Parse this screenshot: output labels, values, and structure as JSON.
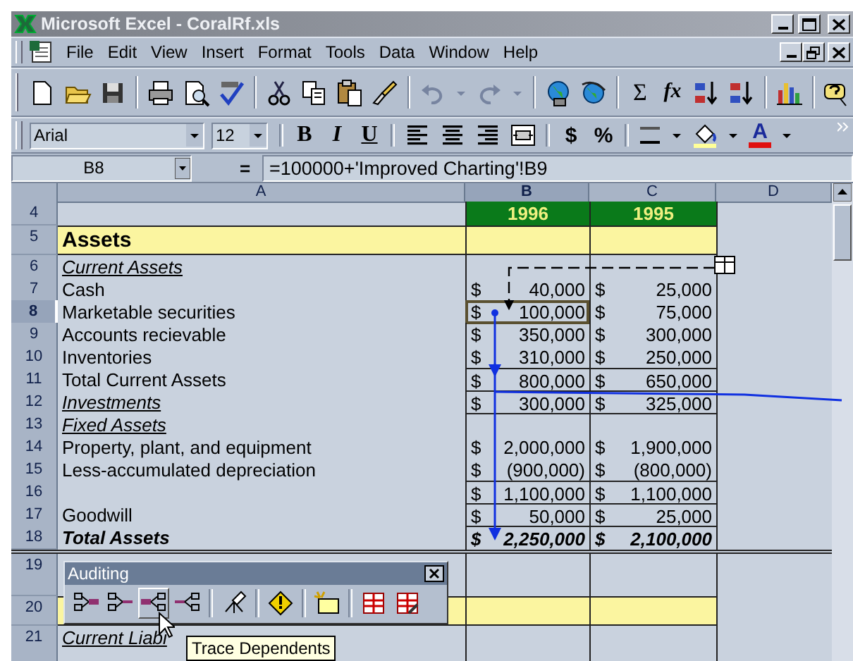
{
  "window": {
    "title": "Microsoft Excel - CoralRf.xls"
  },
  "menu": [
    {
      "label": "File"
    },
    {
      "label": "Edit"
    },
    {
      "label": "View"
    },
    {
      "label": "Insert"
    },
    {
      "label": "Format"
    },
    {
      "label": "Tools"
    },
    {
      "label": "Data"
    },
    {
      "label": "Window"
    },
    {
      "label": "Help"
    }
  ],
  "standard_toolbar": {
    "sum": "Σ",
    "function": "fx"
  },
  "formatting_toolbar": {
    "font": "Arial",
    "size": "12",
    "bold": "B",
    "italic": "I",
    "underline": "U",
    "currency": "$",
    "percent": "%",
    "font_color": "A"
  },
  "formula_bar": {
    "name_box": "B8",
    "equals": "=",
    "formula": "=100000+'Improved Charting'!B9"
  },
  "columns": [
    {
      "label": "A",
      "selected": false
    },
    {
      "label": "B",
      "selected": true
    },
    {
      "label": "C",
      "selected": false
    },
    {
      "label": "D",
      "selected": false
    }
  ],
  "rows": [
    {
      "number": "4",
      "kind": "year-header",
      "selected": false,
      "line_above": false,
      "b": {
        "amount": "1996"
      },
      "c": {
        "amount": "1995"
      }
    },
    {
      "number": "5",
      "kind": "section",
      "selected": false,
      "line_above": false,
      "label": "Assets"
    },
    {
      "number": "6",
      "kind": "subheading",
      "selected": false,
      "line_above": false,
      "label": "Current Assets"
    },
    {
      "number": "7",
      "kind": "item",
      "selected": false,
      "line_above": false,
      "label": "Cash",
      "b": {
        "currency": "$",
        "amount": "40,000"
      },
      "c": {
        "currency": "$",
        "amount": "25,000"
      }
    },
    {
      "number": "8",
      "kind": "item",
      "selected": true,
      "line_above": false,
      "label": "Marketable securities",
      "b": {
        "currency": "$",
        "amount": "100,000"
      },
      "c": {
        "currency": "$",
        "amount": "75,000"
      }
    },
    {
      "number": "9",
      "kind": "item",
      "selected": false,
      "line_above": false,
      "label": "Accounts recievable",
      "b": {
        "currency": "$",
        "amount": "350,000"
      },
      "c": {
        "currency": "$",
        "amount": "300,000"
      }
    },
    {
      "number": "10",
      "kind": "item",
      "selected": false,
      "line_above": false,
      "label": "Inventories",
      "b": {
        "currency": "$",
        "amount": "310,000"
      },
      "c": {
        "currency": "$",
        "amount": "250,000"
      }
    },
    {
      "number": "11",
      "kind": "item",
      "selected": false,
      "line_above": true,
      "label": "Total Current Assets",
      "b": {
        "currency": "$",
        "amount": "800,000"
      },
      "c": {
        "currency": "$",
        "amount": "650,000"
      }
    },
    {
      "number": "12",
      "kind": "subheading",
      "selected": false,
      "line_above": true,
      "label": "Investments",
      "b": {
        "currency": "$",
        "amount": "300,000"
      },
      "c": {
        "currency": "$",
        "amount": "325,000"
      }
    },
    {
      "number": "13",
      "kind": "subheading",
      "selected": false,
      "line_above": true,
      "label": "Fixed Assets"
    },
    {
      "number": "14",
      "kind": "item",
      "selected": false,
      "line_above": false,
      "label": "Property, plant, and equipment",
      "b": {
        "currency": "$",
        "amount": "2,000,000"
      },
      "c": {
        "currency": "$",
        "amount": "1,900,000"
      }
    },
    {
      "number": "15",
      "kind": "item",
      "selected": false,
      "line_above": false,
      "label": "Less-accumulated depreciation",
      "b": {
        "currency": "$",
        "amount": "(900,000)"
      },
      "c": {
        "currency": "$",
        "amount": "(800,000)"
      }
    },
    {
      "number": "16",
      "kind": "item",
      "selected": false,
      "line_above": true,
      "b": {
        "currency": "$",
        "amount": "1,100,000"
      },
      "c": {
        "currency": "$",
        "amount": "1,100,000"
      }
    },
    {
      "number": "17",
      "kind": "item",
      "selected": false,
      "line_above": true,
      "label": "Goodwill",
      "b": {
        "currency": "$",
        "amount": "50,000"
      },
      "c": {
        "currency": "$",
        "amount": "25,000"
      }
    },
    {
      "number": "18",
      "kind": "total",
      "selected": false,
      "line_above": true,
      "label": "Total Assets",
      "b": {
        "currency": "$",
        "amount": "2,250,000"
      },
      "c": {
        "currency": "$",
        "amount": "2,100,000"
      }
    },
    {
      "number": "19",
      "kind": "spacer",
      "selected": false,
      "line_above": false
    },
    {
      "number": "20",
      "kind": "section",
      "selected": false,
      "line_above": false
    },
    {
      "number": "21",
      "kind": "subheading",
      "selected": false,
      "line_above": false,
      "label": "Current Liabi"
    }
  ],
  "auditing_toolbar": {
    "title": "Auditing",
    "buttons": [
      {
        "hovered": false
      },
      {
        "hovered": false
      },
      {
        "hovered": true
      },
      {
        "hovered": false
      },
      {
        "hovered": false
      },
      {
        "hovered": false
      },
      {
        "hovered": false
      },
      {
        "hovered": false
      },
      {
        "hovered": false
      }
    ]
  },
  "tooltip": {
    "text": "Trace Dependents"
  }
}
